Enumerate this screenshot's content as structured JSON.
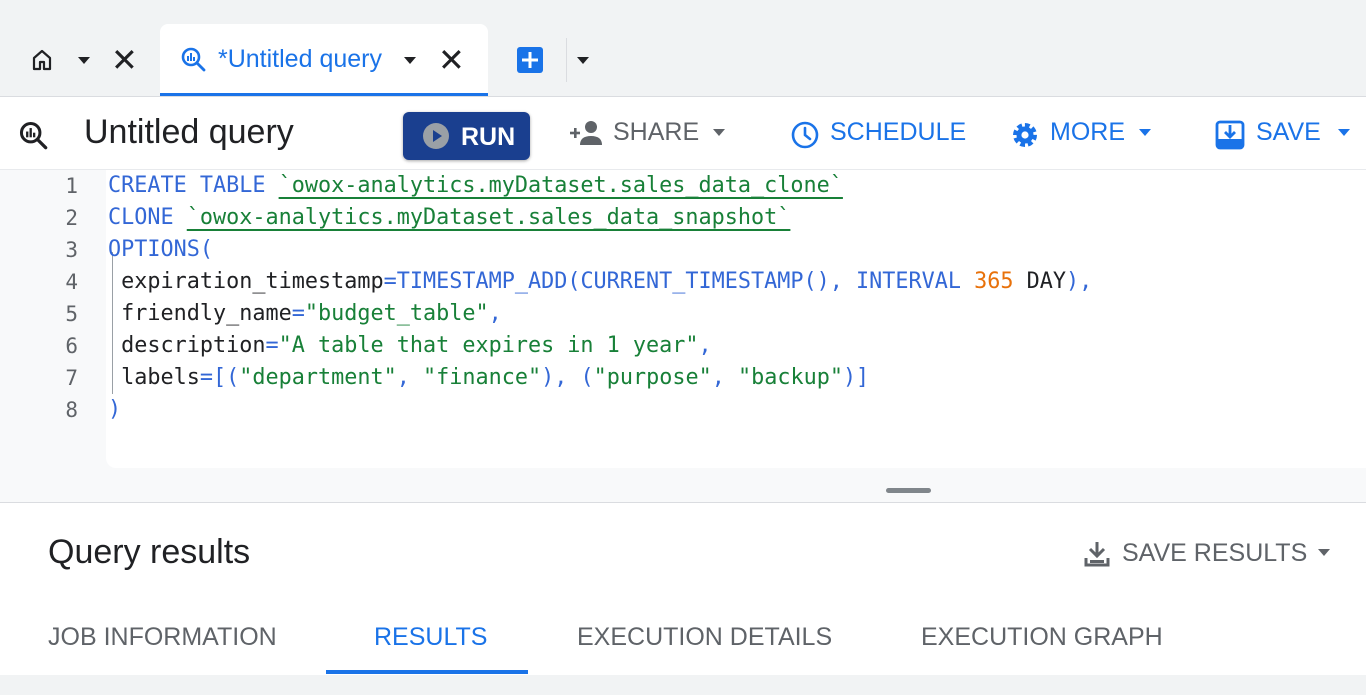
{
  "tabs": {
    "home_icon": "home-icon",
    "active_tab_title": "*Untitled query",
    "active_tab_icon": "query-icon",
    "new_tab_icon": "add-box-icon"
  },
  "toolbar": {
    "query_title": "Untitled query",
    "run_label": "RUN",
    "share_label": "SHARE",
    "schedule_label": "SCHEDULE",
    "more_label": "MORE",
    "save_label": "SAVE"
  },
  "editor": {
    "line_numbers": [
      "1",
      "2",
      "3",
      "4",
      "5",
      "6",
      "7",
      "8"
    ],
    "lines": [
      [
        {
          "t": "CREATE TABLE ",
          "c": "kw"
        },
        {
          "t": "`owox-analytics.myDataset.sales_data_clone`",
          "c": "str ul"
        }
      ],
      [
        {
          "t": "CLONE ",
          "c": "kw"
        },
        {
          "t": "`owox-analytics.myDataset.sales_data_snapshot`",
          "c": "str ul"
        }
      ],
      [
        {
          "t": "OPTIONS(",
          "c": "kw"
        }
      ],
      [
        {
          "t": " expiration_timestamp",
          "c": ""
        },
        {
          "t": "=",
          "c": "kw"
        },
        {
          "t": "TIMESTAMP_ADD(CURRENT_TIMESTAMP(), INTERVAL ",
          "c": "kw"
        },
        {
          "t": "365",
          "c": "num"
        },
        {
          "t": " DAY",
          "c": ""
        },
        {
          "t": "),",
          "c": "kw"
        }
      ],
      [
        {
          "t": " friendly_name",
          "c": ""
        },
        {
          "t": "=",
          "c": "kw"
        },
        {
          "t": "\"budget_table\"",
          "c": "str"
        },
        {
          "t": ",",
          "c": "kw"
        }
      ],
      [
        {
          "t": " description",
          "c": ""
        },
        {
          "t": "=",
          "c": "kw"
        },
        {
          "t": "\"A table that expires in 1 year\"",
          "c": "str"
        },
        {
          "t": ",",
          "c": "kw"
        }
      ],
      [
        {
          "t": " labels",
          "c": ""
        },
        {
          "t": "=[(",
          "c": "kw"
        },
        {
          "t": "\"department\"",
          "c": "str"
        },
        {
          "t": ", ",
          "c": "kw"
        },
        {
          "t": "\"finance\"",
          "c": "str"
        },
        {
          "t": "), (",
          "c": "kw"
        },
        {
          "t": "\"purpose\"",
          "c": "str"
        },
        {
          "t": ", ",
          "c": "kw"
        },
        {
          "t": "\"backup\"",
          "c": "str"
        },
        {
          "t": ")]",
          "c": "kw"
        }
      ],
      [
        {
          "t": ")",
          "c": "kw"
        }
      ]
    ]
  },
  "results": {
    "title": "Query results",
    "save_results_label": "SAVE RESULTS",
    "tabs": [
      "JOB INFORMATION",
      "RESULTS",
      "EXECUTION DETAILS",
      "EXECUTION GRAPH"
    ],
    "active_tab": "RESULTS"
  },
  "colors": {
    "accent": "#1a73e8",
    "run_button": "#1a3f8f",
    "keyword": "#3367d6",
    "string": "#188038",
    "number": "#e8710a"
  }
}
